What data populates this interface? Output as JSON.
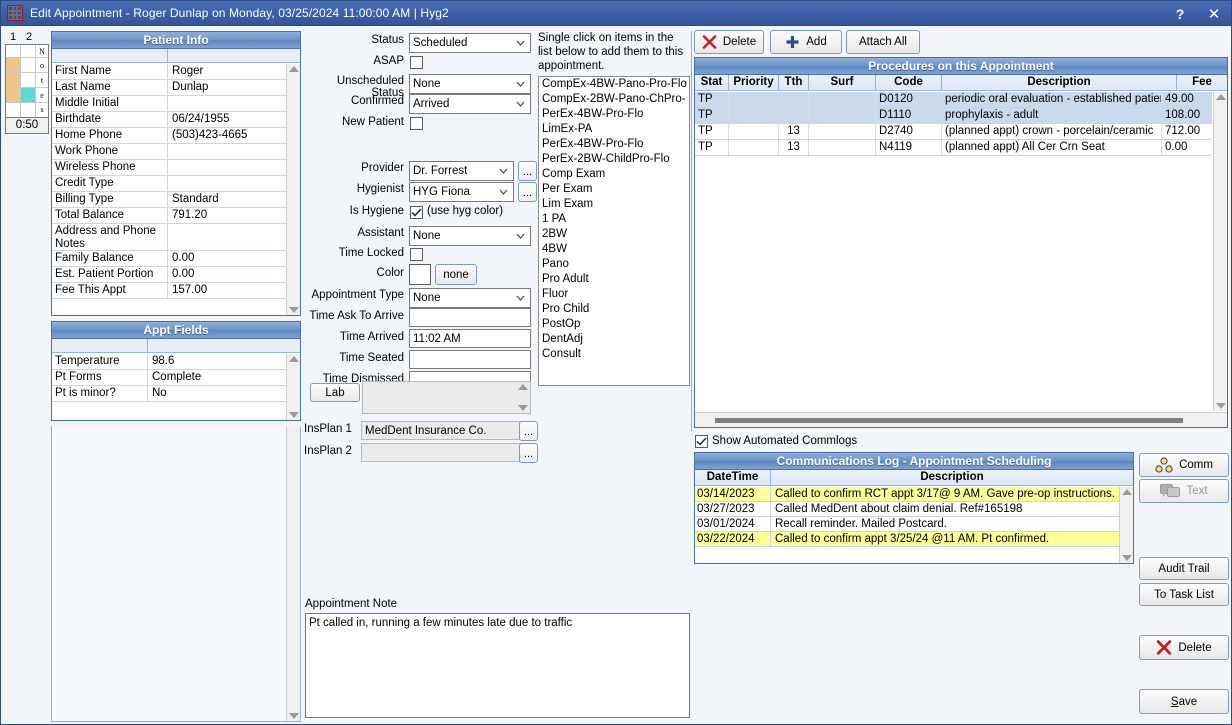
{
  "window": {
    "title": "Edit Appointment - Roger Dunlap on Monday, 03/25/2024 11:00:00 AM | Hyg2",
    "help_label": "?",
    "close_label": "✕"
  },
  "timebar": {
    "col1_label": "1",
    "col2_label": "2",
    "vertical_text": [
      "N",
      "o",
      "t",
      "e",
      "s"
    ],
    "duration": "0:50",
    "block_color": "#eec58a",
    "highlight_color": "#5fd9cf"
  },
  "patient_info": {
    "caption": "Patient Info",
    "rows": [
      {
        "label": "First Name",
        "value": "Roger"
      },
      {
        "label": "Last Name",
        "value": "Dunlap"
      },
      {
        "label": "Middle Initial",
        "value": ""
      },
      {
        "label": "Birthdate",
        "value": "06/24/1955"
      },
      {
        "label": "Home Phone",
        "value": "(503)423-4665"
      },
      {
        "label": "Work Phone",
        "value": ""
      },
      {
        "label": "Wireless Phone",
        "value": ""
      },
      {
        "label": "Credit Type",
        "value": ""
      },
      {
        "label": "Billing Type",
        "value": "Standard"
      },
      {
        "label": "Total Balance",
        "value": "791.20"
      },
      {
        "label": "Address and Phone Notes",
        "value": ""
      },
      {
        "label": "Family Balance",
        "value": "0.00"
      },
      {
        "label": "Est. Patient Portion",
        "value": "0.00"
      },
      {
        "label": "Fee This Appt",
        "value": "157.00"
      }
    ]
  },
  "appt_fields": {
    "caption": "Appt Fields",
    "rows": [
      {
        "label": "Temperature",
        "value": "98.6"
      },
      {
        "label": "Pt Forms",
        "value": "Complete"
      },
      {
        "label": "Pt is minor?",
        "value": "No"
      }
    ]
  },
  "form": {
    "status_label": "Status",
    "status_value": "Scheduled",
    "asap_label": "ASAP",
    "asap_checked": false,
    "unsched_label": "Unscheduled Status",
    "unsched_value": "None",
    "confirmed_label": "Confirmed",
    "confirmed_value": "Arrived",
    "newpatient_label": "New Patient",
    "newpatient_checked": false,
    "provider_label": "Provider",
    "provider_value": "Dr. Forrest",
    "hygienist_label": "Hygienist",
    "hygienist_value": "HYG Fiona",
    "ishygiene_label": "Is Hygiene",
    "ishygiene_checked": true,
    "usehygcolor_label": "(use hyg color)",
    "assistant_label": "Assistant",
    "assistant_value": "None",
    "timelocked_label": "Time Locked",
    "timelocked_checked": false,
    "color_label": "Color",
    "color_none_label": "none",
    "appttype_label": "Appointment Type",
    "appttype_value": "None",
    "time_ask_label": "Time Ask To Arrive",
    "time_ask_value": "",
    "time_arrived_label": "Time Arrived",
    "time_arrived_value": "11:02 AM",
    "time_seated_label": "Time Seated",
    "time_seated_value": "",
    "time_dismissed_label": "Time Dismissed",
    "time_dismissed_value": "",
    "lab_label": "Lab",
    "lab_value": "",
    "insplan1_label": "InsPlan 1",
    "insplan1_value": "MedDent Insurance Co.",
    "insplan2_label": "InsPlan 2",
    "insplan2_value": "",
    "ellipsis_label": "...",
    "appt_note_label": "Appointment Note",
    "appt_note_value": "Pt called in, running a few minutes late due to traffic"
  },
  "quick_add": {
    "hint": "Single click on items in the list below to add them to this appointment.",
    "items": [
      "CompEx-4BW-Pano-Pro-Flo",
      "CompEx-2BW-Pano-ChPro-",
      "PerEx-4BW-Pro-Flo",
      "LimEx-PA",
      "PerEx-4BW-Pro-Flo",
      "PerEx-2BW-ChildPro-Flo",
      "Comp Exam",
      "Per Exam",
      "Lim Exam",
      "1 PA",
      "2BW",
      "4BW",
      "Pano",
      "Pro Adult",
      "Fluor",
      "Pro Child",
      "PostOp",
      "DentAdj",
      "Consult"
    ]
  },
  "procedures": {
    "delete_label": "Delete",
    "add_label": "Add",
    "attach_all_label": "Attach All",
    "caption": "Procedures on this Appointment",
    "columns": [
      "Stat",
      "Priority",
      "Tth",
      "Surf",
      "Code",
      "Description",
      "Fee"
    ],
    "rows": [
      {
        "stat": "TP",
        "priority": "",
        "tth": "",
        "surf": "",
        "code": "D0120",
        "description": "periodic oral evaluation - established patient",
        "fee": "49.00",
        "selected": true
      },
      {
        "stat": "TP",
        "priority": "",
        "tth": "",
        "surf": "",
        "code": "D1110",
        "description": "prophylaxis - adult",
        "fee": "108.00",
        "selected": true
      },
      {
        "stat": "TP",
        "priority": "",
        "tth": "13",
        "surf": "",
        "code": "D2740",
        "description": "(planned appt) crown - porcelain/ceramic",
        "fee": "712.00",
        "selected": false
      },
      {
        "stat": "TP",
        "priority": "",
        "tth": "13",
        "surf": "",
        "code": "N4119",
        "description": "(planned appt) All Cer Crn Seat",
        "fee": "0.00",
        "selected": false
      }
    ]
  },
  "commlog": {
    "show_automated_label": "Show Automated Commlogs",
    "show_automated_checked": true,
    "caption": "Communications Log - Appointment Scheduling",
    "columns": [
      "DateTime",
      "Description"
    ],
    "rows": [
      {
        "datetime": "03/14/2023",
        "description": "Called to confirm RCT appt 3/17@ 9 AM. Gave pre-op instructions.",
        "highlight": true
      },
      {
        "datetime": "03/27/2023",
        "description": "Called MedDent about claim denial. Ref#165198",
        "highlight": false
      },
      {
        "datetime": "03/01/2024",
        "description": "Recall reminder. Mailed Postcard.",
        "highlight": false
      },
      {
        "datetime": "03/22/2024",
        "description": "Called to confirm appt 3/25/24 @11 AM. Pt confirmed.",
        "highlight": true
      }
    ]
  },
  "sidebuttons": {
    "comm_label": "Comm",
    "text_label": "Text",
    "text_disabled": true,
    "audit_trail_label": "Audit Trail",
    "to_task_list_label": "To Task List",
    "delete_label": "Delete",
    "save_label": "Save",
    "save_accel": "S",
    "save_rest": "ave"
  },
  "colors": {
    "titlebar": "#3c5fa8",
    "caption_bar": "#6f93c8",
    "highlight_row": "#ffff99",
    "selected_row": "#ccd9ec",
    "delete_x": "#c0202a",
    "add_plus": "#2a4a9a"
  }
}
